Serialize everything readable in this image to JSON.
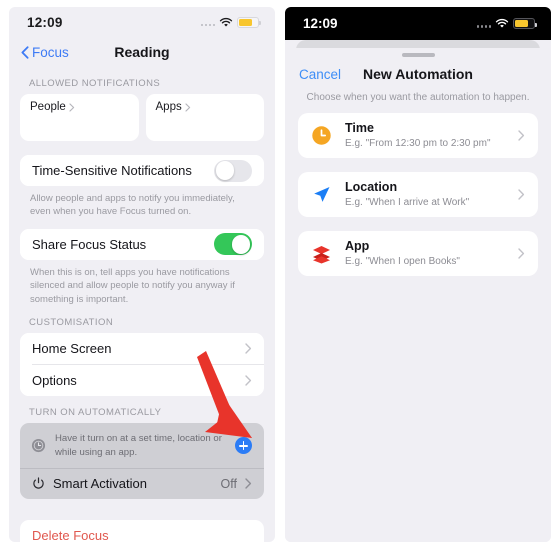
{
  "left_phone": {
    "status_bar": {
      "time": "12:09",
      "wifi_icon": "wifi-icon",
      "battery_icon": "battery-icon",
      "signal_icon": "signal-dots-icon"
    },
    "nav": {
      "back_label": "Focus",
      "back_icon": "chevron-left-icon",
      "title": "Reading"
    },
    "allowed_notifications": {
      "header": "ALLOWED NOTIFICATIONS",
      "cards": [
        {
          "label": "People",
          "chevron_icon": "chevron-right-icon"
        },
        {
          "label": "Apps",
          "chevron_icon": "chevron-right-icon"
        }
      ]
    },
    "time_sensitive": {
      "label": "Time-Sensitive Notifications",
      "toggle_state": "off",
      "footnote": "Allow people and apps to notify you immediately, even when you have Focus turned on."
    },
    "share_focus": {
      "label": "Share Focus Status",
      "toggle_state": "on",
      "footnote": "When this is on, tell apps you have notifications silenced and allow people to notify you anyway if something is important."
    },
    "customisation": {
      "header": "CUSTOMISATION",
      "rows": [
        {
          "label": "Home Screen",
          "chevron_icon": "chevron-right-icon"
        },
        {
          "label": "Options",
          "chevron_icon": "chevron-right-icon"
        }
      ]
    },
    "turn_on_automatically": {
      "header": "TURN ON AUTOMATICALLY",
      "hint_icon": "clock-badge-icon",
      "hint_text": "Have it turn on at a set time, location or while using an app.",
      "add_button_icon": "plus-icon",
      "smart_activation": {
        "icon": "power-icon",
        "label": "Smart Activation",
        "value": "Off",
        "chevron_icon": "chevron-right-icon"
      }
    },
    "delete": {
      "label": "Delete Focus",
      "color": "#e0584f"
    }
  },
  "annotation": {
    "arrow_icon": "red-arrow-icon",
    "color": "#e8342b"
  },
  "right_phone": {
    "status_bar": {
      "time": "12:09",
      "wifi_icon": "wifi-icon",
      "battery_icon": "battery-icon",
      "signal_icon": "signal-dots-icon"
    },
    "sheet": {
      "grabber_icon": "sheet-grabber-icon",
      "cancel_label": "Cancel",
      "title": "New Automation",
      "subtitle": "Choose when you want the automation to happen.",
      "options": [
        {
          "icon": "clock-icon",
          "icon_color": "#f5a623",
          "title": "Time",
          "subtitle": "E.g. \"From 12:30 pm to 2:30 pm\"",
          "chevron_icon": "chevron-right-icon"
        },
        {
          "icon": "location-arrow-icon",
          "icon_color": "#1b7ef5",
          "title": "Location",
          "subtitle": "E.g. \"When I arrive at Work\"",
          "chevron_icon": "chevron-right-icon"
        },
        {
          "icon": "app-stack-icon",
          "icon_color": "#e8342b",
          "title": "App",
          "subtitle": "E.g. \"When I open Books\"",
          "chevron_icon": "chevron-right-icon"
        }
      ]
    }
  }
}
